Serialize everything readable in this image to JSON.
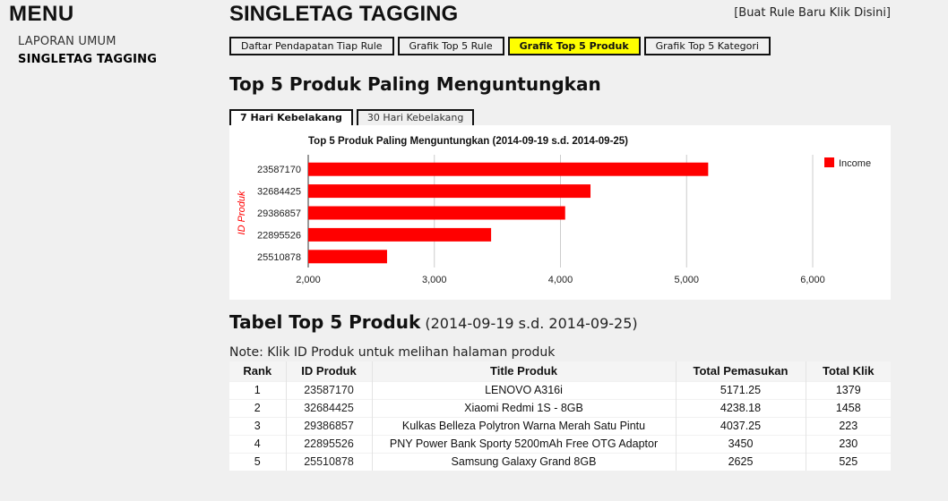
{
  "sidebar": {
    "title": "MENU",
    "items": [
      {
        "label": "LAPORAN UMUM"
      },
      {
        "label": "SINGLETAG TAGGING"
      }
    ]
  },
  "header": {
    "title": "SINGLETAG TAGGING",
    "new_rule_link": "[Buat Rule Baru Klik Disini]"
  },
  "tabs": [
    {
      "label": "Daftar Pendapatan Tiap Rule"
    },
    {
      "label": "Grafik Top 5 Rule"
    },
    {
      "label": "Grafik Top 5 Produk"
    },
    {
      "label": "Grafik Top 5 Kategori"
    }
  ],
  "section_title": "Top 5 Produk Paling Menguntungkan",
  "range_tabs": [
    {
      "label": "7 Hari Kebelakang"
    },
    {
      "label": "30 Hari Kebelakang"
    }
  ],
  "colors": {
    "bar": "#ff0000",
    "active_tab": "#ffff00",
    "axis_label": "#ff0000"
  },
  "chart_data": {
    "type": "bar",
    "orientation": "horizontal",
    "title": "Top 5 Produk Paling Menguntungkan (2014-09-19 s.d. 2014-09-25)",
    "categories": [
      "23587170",
      "32684425",
      "29386857",
      "22895526",
      "25510878"
    ],
    "series": [
      {
        "name": "Income",
        "values": [
          5171.25,
          4238.18,
          4037.25,
          3450,
          2625
        ]
      }
    ],
    "xlim": [
      2000,
      6000
    ],
    "xticks": [
      2000,
      3000,
      4000,
      5000,
      6000
    ],
    "xtick_labels": [
      "2,000",
      "3,000",
      "4,000",
      "5,000",
      "6,000"
    ],
    "xlabel": "",
    "ylabel": "ID Produk",
    "grid": true,
    "legend": "top-right"
  },
  "table": {
    "heading": "Tabel Top 5 Produk",
    "range": "(2014-09-19 s.d. 2014-09-25)",
    "note": "Note: Klik ID Produk untuk melihan halaman produk",
    "columns": [
      "Rank",
      "ID Produk",
      "Title Produk",
      "Total Pemasukan",
      "Total Klik"
    ],
    "rows": [
      [
        "1",
        "23587170",
        "LENOVO A316i",
        "5171.25",
        "1379"
      ],
      [
        "2",
        "32684425",
        "Xiaomi Redmi 1S - 8GB",
        "4238.18",
        "1458"
      ],
      [
        "3",
        "29386857",
        "Kulkas Belleza Polytron Warna Merah Satu Pintu",
        "4037.25",
        "223"
      ],
      [
        "4",
        "22895526",
        "PNY Power Bank Sporty 5200mAh Free OTG Adaptor",
        "3450",
        "230"
      ],
      [
        "5",
        "25510878",
        "Samsung Galaxy Grand 8GB",
        "2625",
        "525"
      ]
    ]
  }
}
